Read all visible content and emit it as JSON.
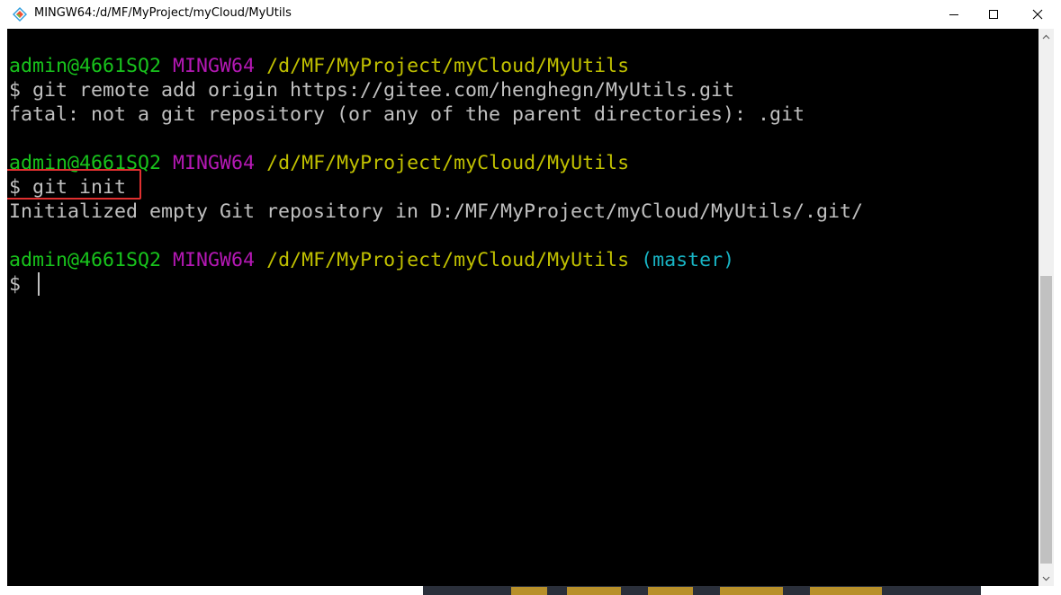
{
  "window": {
    "title": "MINGW64:/d/MF/MyProject/myCloud/MyUtils"
  },
  "controls": {
    "minimize_icon": "minimize-icon",
    "maximize_icon": "maximize-icon",
    "close_icon": "close-icon"
  },
  "terminal": {
    "background": "#000000",
    "prompt1": {
      "user": "admin@4661SQ2",
      "system": "MINGW64",
      "path": "/d/MF/MyProject/myCloud/MyUtils"
    },
    "cmd1": "$ git remote add origin https://gitee.com/henghegn/MyUtils.git",
    "out1": "fatal: not a git repository (or any of the parent directories): .git",
    "prompt2": {
      "user": "admin@4661SQ2",
      "system": "MINGW64",
      "path": "/d/MF/MyProject/myCloud/MyUtils"
    },
    "cmd2": "$ git init",
    "out2": "Initialized empty Git repository in D:/MF/MyProject/myCloud/MyUtils/.git/",
    "prompt3": {
      "user": "admin@4661SQ2",
      "system": "MINGW64",
      "path": "/d/MF/MyProject/myCloud/MyUtils",
      "branch": "(master)"
    },
    "cmd3": "$ "
  },
  "colors": {
    "user": "#18c41c",
    "system": "#b418b4",
    "path": "#c0c000",
    "branch": "#18b4c4",
    "text": "#c0c0c0",
    "highlight": "#e03030"
  }
}
